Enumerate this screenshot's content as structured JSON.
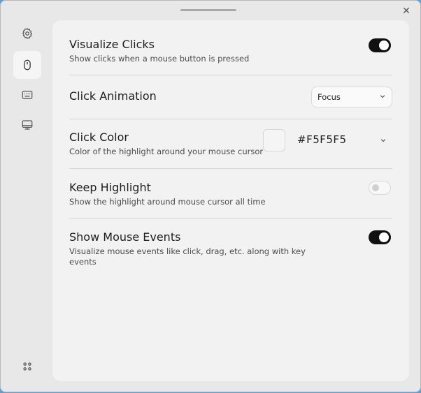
{
  "window": {
    "close_glyph": "✕"
  },
  "sidebar": {
    "items": [
      {
        "icon": "gear-icon",
        "active": false
      },
      {
        "icon": "mouse-icon",
        "active": true
      },
      {
        "icon": "keyboard-icon",
        "active": false
      },
      {
        "icon": "monitor-icon",
        "active": false
      }
    ],
    "bottom_icon": "apps-grid-icon"
  },
  "settings": {
    "visualize_clicks": {
      "title": "Visualize Clicks",
      "description": "Show clicks when a mouse button is pressed",
      "enabled": true
    },
    "click_animation": {
      "title": "Click Animation",
      "selected": "Focus"
    },
    "click_color": {
      "title": "Click Color",
      "description": "Color of the highlight around your mouse cursor",
      "value": "#F5F5F5"
    },
    "keep_highlight": {
      "title": "Keep Highlight",
      "description": "Show the highlight around mouse cursor all time",
      "enabled": false
    },
    "show_mouse_events": {
      "title": "Show Mouse Events",
      "description": "Visualize mouse events like click, drag, etc. along with key events",
      "enabled": true
    }
  },
  "colors": {
    "toggle_on": "#111111",
    "panel_bg": "#F2F2F2",
    "window_bg": "#E8E8E8"
  }
}
